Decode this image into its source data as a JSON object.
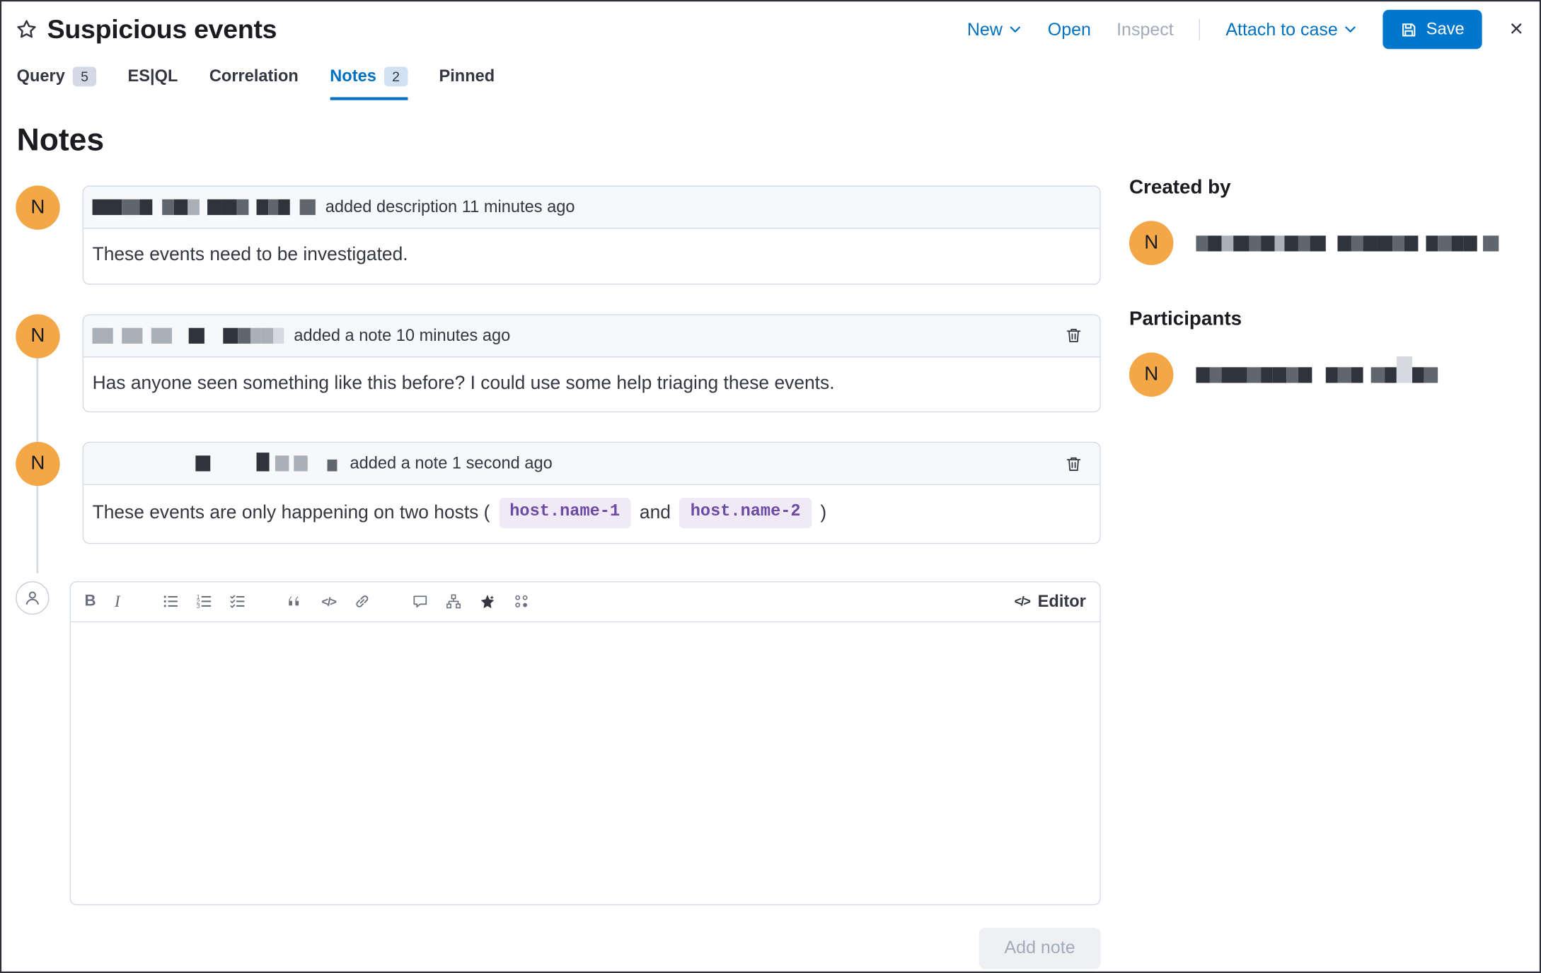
{
  "header": {
    "title": "Suspicious events",
    "new_label": "New",
    "open_label": "Open",
    "inspect_label": "Inspect",
    "attach_label": "Attach to case",
    "save_label": "Save"
  },
  "tabs": {
    "query": {
      "label": "Query",
      "badge": "5"
    },
    "esql": {
      "label": "ES|QL"
    },
    "correlation": {
      "label": "Correlation"
    },
    "notes": {
      "label": "Notes",
      "badge": "2"
    },
    "pinned": {
      "label": "Pinned"
    }
  },
  "page": {
    "heading": "Notes"
  },
  "avatar": {
    "initial": "N"
  },
  "notes": [
    {
      "action": "added description 11 minutes ago",
      "body": "These events need to be investigated."
    },
    {
      "action": "added a note 10 minutes ago",
      "body": "Has anyone seen something like this before? I could use some help triaging these events."
    },
    {
      "action": "added a note 1 second ago",
      "body_prefix": "These events are only happening on two hosts (",
      "host1": "host.name-1",
      "body_and": "and",
      "host2": "host.name-2",
      "body_suffix": ")"
    }
  ],
  "editor": {
    "label": "Editor",
    "add_note_label": "Add note"
  },
  "sidebar": {
    "created_by": "Created by",
    "participants": "Participants"
  },
  "colors": {
    "primary_link": "#0071c2",
    "save_button": "#0077cc",
    "avatar": "#f3a747",
    "code_chip_text": "#6d4aa3"
  }
}
